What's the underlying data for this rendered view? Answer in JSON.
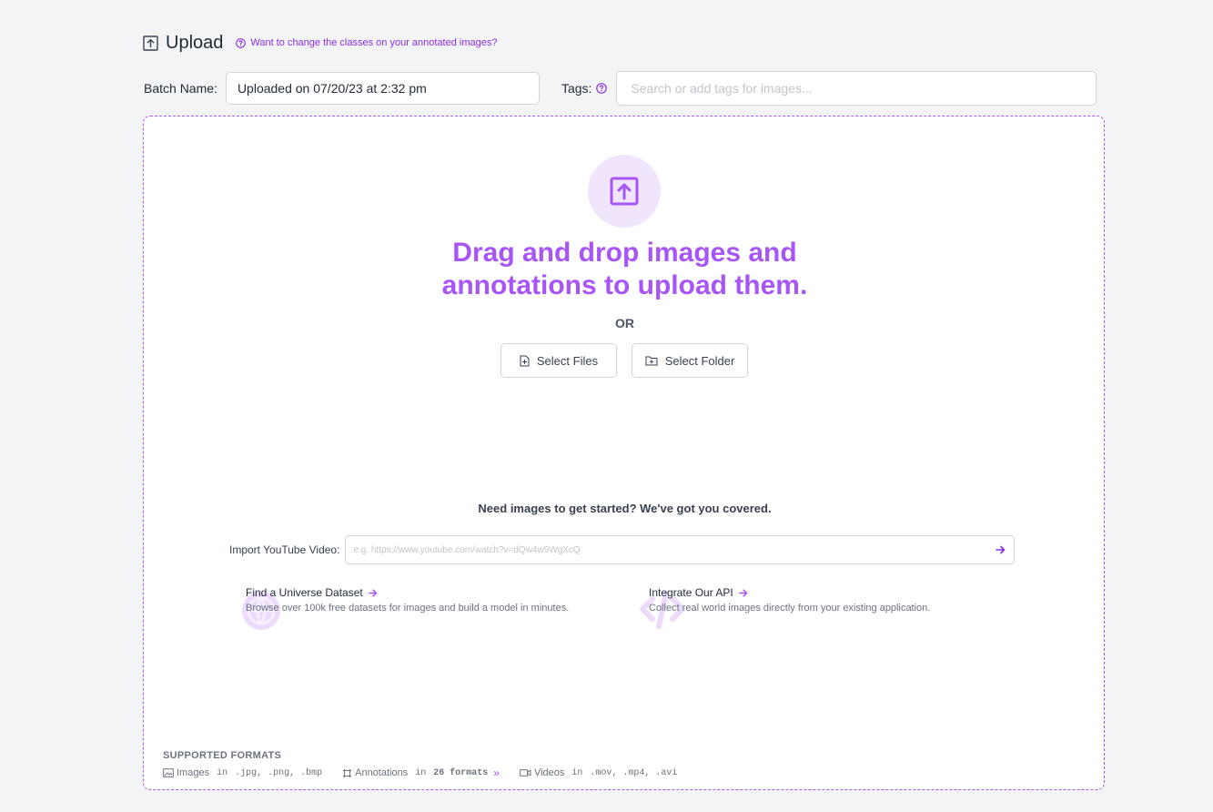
{
  "header": {
    "title": "Upload",
    "help_link": "Want to change the classes on your annotated images?"
  },
  "batch": {
    "label": "Batch Name:",
    "value": "Uploaded on 07/20/23 at 2:32 pm"
  },
  "tags": {
    "label": "Tags:",
    "placeholder": "Search or add tags for images..."
  },
  "dropzone": {
    "heading_line1": "Drag and drop images and",
    "heading_line2": "annotations to upload them.",
    "or": "OR",
    "select_files": "Select Files",
    "select_folder": "Select Folder"
  },
  "resources": {
    "intro": "Need images to get started? We've got you covered.",
    "youtube_label": "Import YouTube Video:",
    "youtube_placeholder": "e.g. https://www.youtube.com/watch?v=dQw4w9WgXcQ",
    "universe_title": "Find a Universe Dataset",
    "universe_desc": "Browse over 100k free datasets for images and build a model in minutes.",
    "api_title": "Integrate Our API",
    "api_desc": "Collect real world images directly from your existing application."
  },
  "formats": {
    "title": "SUPPORTED FORMATS",
    "images_label": "Images",
    "in": "in",
    "images_exts": ".jpg, .png, .bmp",
    "annotations_label": "Annotations",
    "annotations_count": "26 formats",
    "videos_label": "Videos",
    "videos_exts": ".mov, .mp4, .avi"
  },
  "colors": {
    "accent": "#a855f7",
    "accent_light": "#f1e4fd",
    "background": "#f3f4f6"
  }
}
